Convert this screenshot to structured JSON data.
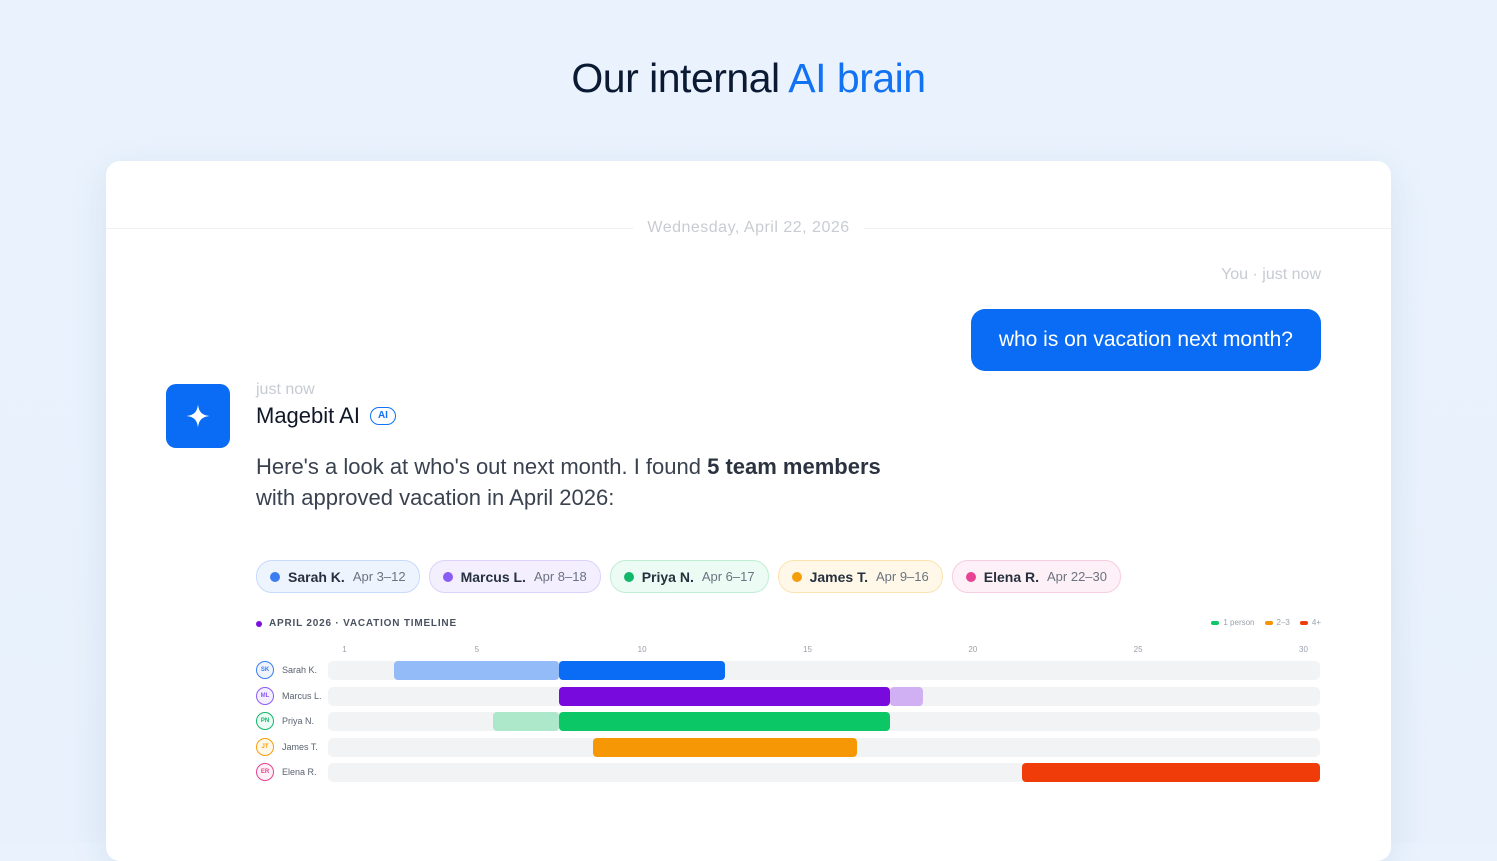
{
  "hero": {
    "title_prefix": "Our internal",
    "title_accent": "AI brain",
    "accent_color": "#1273f2"
  },
  "chat": {
    "date_separator": "Wednesday, April 22, 2026",
    "user": {
      "meta": "You · just now",
      "message": "who is on vacation next month?"
    },
    "ai": {
      "avatar_icon": "sparkle-icon",
      "time": "just now",
      "name": "Magebit AI",
      "badge": "AI",
      "msg_part1": "Here's a look at who's out next month. I found",
      "msg_bold": "5 team members",
      "msg_part2": "with approved vacation in April 2026:"
    }
  },
  "people": [
    {
      "name": "Sarah K.",
      "initials": "SK",
      "dates": "Apr 3–12",
      "color": "#3b7df0",
      "chip_bg": "#eef4fe",
      "chip_border": "#c7dafb"
    },
    {
      "name": "Marcus L.",
      "initials": "ML",
      "dates": "Apr 8–18",
      "color": "#8b5cf6",
      "chip_bg": "#f3effe",
      "chip_border": "#ddd2fb"
    },
    {
      "name": "Priya N.",
      "initials": "PN",
      "dates": "Apr 6–17",
      "color": "#12b76a",
      "chip_bg": "#ecfbf3",
      "chip_border": "#bfeed5"
    },
    {
      "name": "James T.",
      "initials": "JT",
      "dates": "Apr 9–16",
      "color": "#f59e0b",
      "chip_bg": "#fff8e8",
      "chip_border": "#fbe3b0"
    },
    {
      "name": "Elena R.",
      "initials": "ER",
      "dates": "Apr 22–30",
      "color": "#e84393",
      "chip_bg": "#fdf0f6",
      "chip_border": "#f7cde1"
    }
  ],
  "timeline": {
    "title": "APRIL 2026 · VACATION TIMELINE",
    "legend": [
      {
        "label": "1 person",
        "color": "#0cc765"
      },
      {
        "label": "2–3",
        "color": "#f39505"
      },
      {
        "label": "4+",
        "color": "#ee3d0a"
      }
    ]
  },
  "chart_data": {
    "type": "bar",
    "title": "APRIL 2026 · VACATION TIMELINE",
    "x_ticks": [
      1,
      5,
      10,
      15,
      20,
      25,
      30
    ],
    "xlim": [
      1,
      30
    ],
    "series": [
      {
        "name": "Sarah K.",
        "segments": [
          {
            "from": 3,
            "to": 8,
            "color": "#93bbf7"
          },
          {
            "from": 8,
            "to": 13,
            "color": "#0a6cf5"
          }
        ]
      },
      {
        "name": "Marcus L.",
        "segments": [
          {
            "from": 8,
            "to": 18,
            "color": "#780ade"
          },
          {
            "from": 18,
            "to": 19,
            "color": "#d0b0f2"
          }
        ]
      },
      {
        "name": "Priya N.",
        "segments": [
          {
            "from": 6,
            "to": 8,
            "color": "#aee8cb"
          },
          {
            "from": 8,
            "to": 18,
            "color": "#0cc765"
          }
        ]
      },
      {
        "name": "James T.",
        "segments": [
          {
            "from": 9,
            "to": 17,
            "color": "#f69705"
          }
        ]
      },
      {
        "name": "Elena R.",
        "segments": [
          {
            "from": 22,
            "to": 31,
            "color": "#ef3c08"
          }
        ]
      }
    ]
  }
}
